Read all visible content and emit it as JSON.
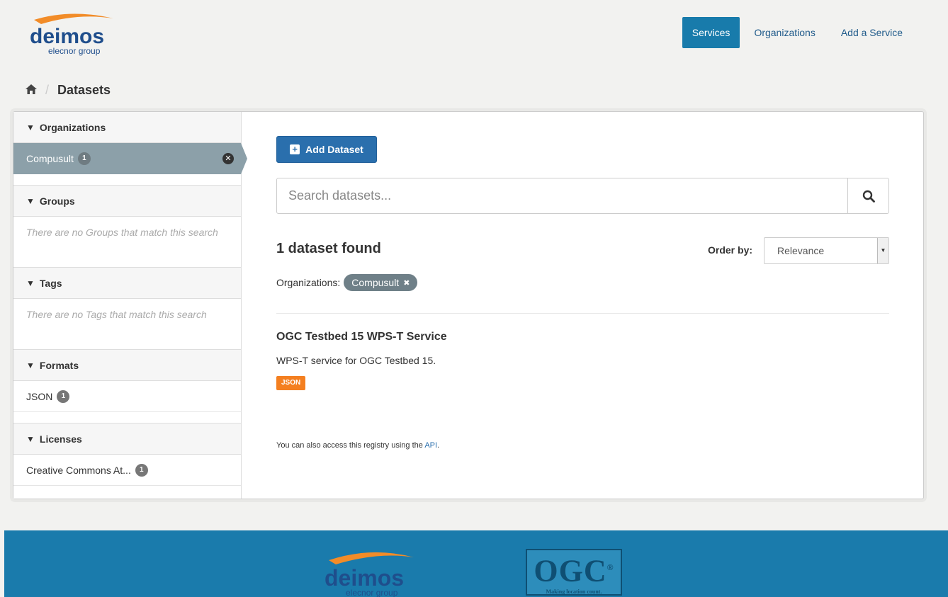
{
  "header": {
    "logo_text": "deimos",
    "logo_sub": "elecnor group",
    "nav": [
      "Services",
      "Organizations",
      "Add a Service"
    ]
  },
  "breadcrumb": {
    "current": "Datasets"
  },
  "facets": {
    "organizations": {
      "title": "Organizations",
      "active_item": "Compusult",
      "active_count": "1"
    },
    "groups": {
      "title": "Groups",
      "empty": "There are no Groups that match this search"
    },
    "tags": {
      "title": "Tags",
      "empty": "There are no Tags that match this search"
    },
    "formats": {
      "title": "Formats",
      "item": "JSON",
      "count": "1"
    },
    "licenses": {
      "title": "Licenses",
      "item": "Creative Commons At...",
      "count": "1"
    }
  },
  "main": {
    "add_button": "Add Dataset",
    "search_placeholder": "Search datasets...",
    "result_count": "1 dataset found",
    "order_label": "Order by:",
    "order_value": "Relevance",
    "filter_label": "Organizations:",
    "filter_pill": "Compusult",
    "dataset": {
      "title": "OGC Testbed 15 WPS-T Service",
      "description": "WPS-T service for OGC Testbed 15.",
      "format": "JSON"
    },
    "api_note": "You can also access this registry using the",
    "api_link": "API",
    "api_suffix": "."
  },
  "footer": {
    "logo_text": "deimos",
    "logo_sub": "elecnor group",
    "ogc_text": "OGC",
    "ogc_mark": "®",
    "ogc_tagline": "Making location count."
  },
  "colors": {
    "accent": "#187bab",
    "footer": "#1a7bac",
    "active_facet": "#8ca0a9",
    "format_tag": "#f47f20",
    "add_button": "#2a6fad"
  },
  "icons": [
    "home-icon",
    "filter-icon",
    "search-icon",
    "plus-square-icon",
    "remove-icon",
    "caret-down-icon"
  ]
}
